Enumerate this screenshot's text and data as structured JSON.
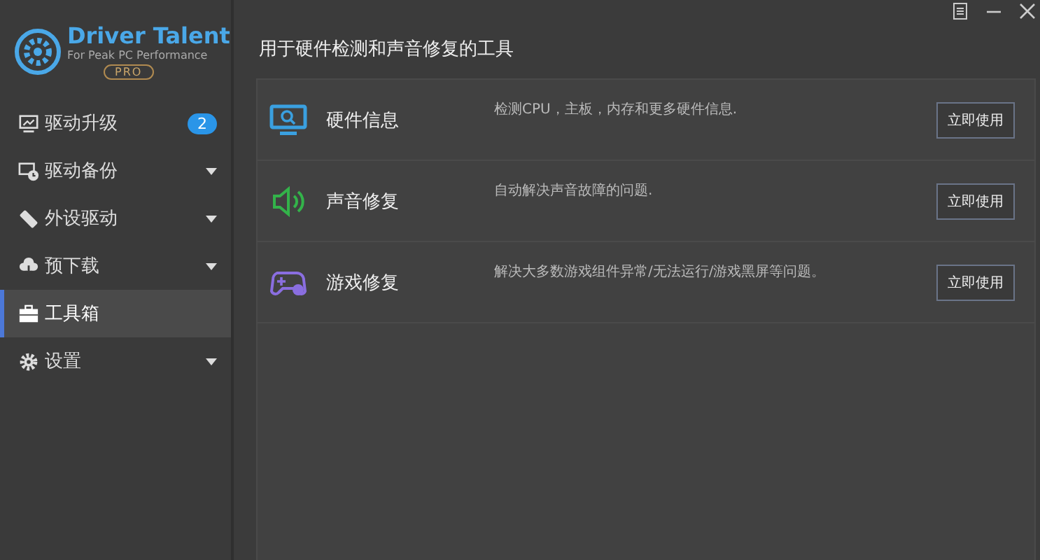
{
  "logo": {
    "title": "Driver Talent",
    "tagline": "For Peak PC Performance",
    "edition": "PRO"
  },
  "sidebar": {
    "items": [
      {
        "kind": "upgrade",
        "label": "驱动升级",
        "badge": "2",
        "expandable": false,
        "selected": false
      },
      {
        "kind": "backup",
        "label": "驱动备份",
        "expandable": true,
        "selected": false
      },
      {
        "kind": "peripheral",
        "label": "外设驱动",
        "expandable": true,
        "selected": false
      },
      {
        "kind": "download",
        "label": "预下载",
        "expandable": true,
        "selected": false
      },
      {
        "kind": "toolbox",
        "label": "工具箱",
        "expandable": false,
        "selected": true
      },
      {
        "kind": "settings",
        "label": "设置",
        "expandable": true,
        "selected": false
      }
    ]
  },
  "heading": "用于硬件检测和声音修复的工具",
  "tools": [
    {
      "kind": "hardware",
      "name": "硬件信息",
      "description": "检测CPU，主板，内存和更多硬件信息.",
      "button": "立即使用"
    },
    {
      "kind": "sound",
      "name": "声音修复",
      "description": "自动解决声音故障的问题.",
      "button": "立即使用"
    },
    {
      "kind": "game",
      "name": "游戏修复",
      "description": "解决大多数游戏组件异常/无法运行/游戏黑屏等问题。",
      "button": "立即使用"
    }
  ]
}
